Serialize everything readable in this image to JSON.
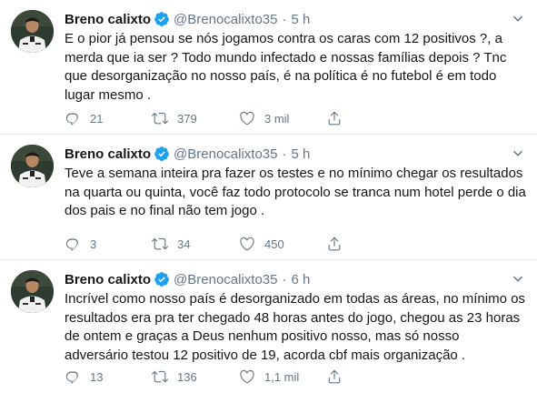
{
  "accent": "#1da1f2",
  "tweets": [
    {
      "name": "Breno calixto",
      "handle": "@Brenocalixto35",
      "separator": "·",
      "time": "5 h",
      "text": "E o pior já pensou se nós jogamos contra os caras com 12 positivos ?, a merda que ia ser ? Todo mundo infectado e nossas famílias depois ? Tnc que desorganização no nosso país, é na política é no futebol é em todo lugar mesmo .",
      "replies": "21",
      "retweets": "379",
      "likes": "3 mil",
      "icons": {
        "reply": "reply-icon",
        "retweet": "retweet-icon",
        "like": "like-icon",
        "share": "share-icon",
        "verified": "verified-badge-icon",
        "more": "chevron-down-icon"
      }
    },
    {
      "name": "Breno calixto",
      "handle": "@Brenocalixto35",
      "separator": "·",
      "time": "5 h",
      "text": "Teve a semana inteira pra fazer os testes e no mínimo chegar os resultados na quarta ou quinta, você faz todo protocolo se tranca num hotel perde o dia dos pais e no final não tem jogo .",
      "replies": "3",
      "retweets": "34",
      "likes": "450",
      "icons": {
        "reply": "reply-icon",
        "retweet": "retweet-icon",
        "like": "like-icon",
        "share": "share-icon",
        "verified": "verified-badge-icon",
        "more": "chevron-down-icon"
      }
    },
    {
      "name": "Breno calixto",
      "handle": "@Brenocalixto35",
      "separator": "·",
      "time": "6 h",
      "text": "Incrível como nosso país é desorganizado em todas as áreas, no mínimo os resultados era pra ter chegado 48 horas antes do jogo, chegou as 23 horas de ontem e graças a Deus nenhum positivo nosso, mas só nosso adversário testou 12 positivo de 19, acorda cbf mais organização .",
      "replies": "13",
      "retweets": "136",
      "likes": "1,1 mil",
      "icons": {
        "reply": "reply-icon",
        "retweet": "retweet-icon",
        "like": "like-icon",
        "share": "share-icon",
        "verified": "verified-badge-icon",
        "more": "chevron-down-icon"
      }
    }
  ]
}
